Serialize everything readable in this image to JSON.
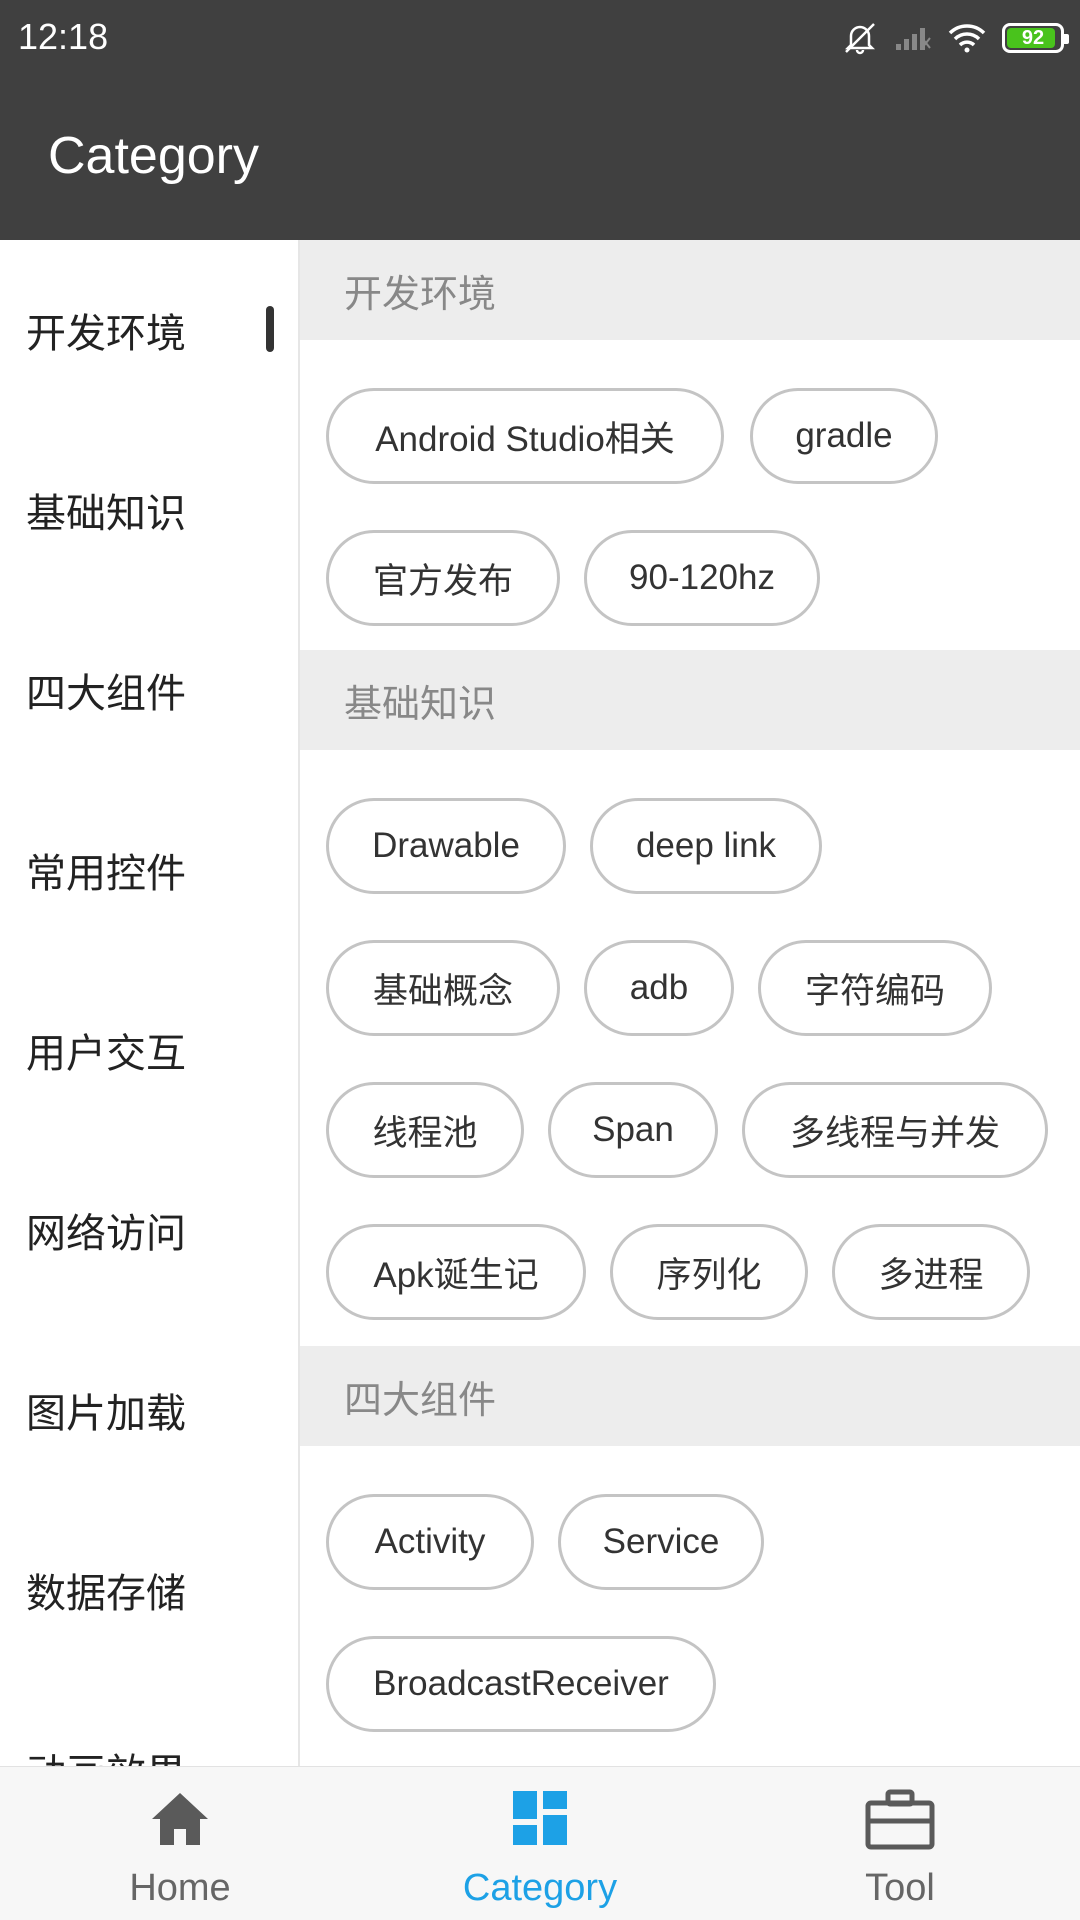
{
  "status_bar": {
    "time": "12:18",
    "battery_level": "92",
    "icons": [
      "mute-icon",
      "signal-icon",
      "wifi-icon",
      "battery-icon"
    ]
  },
  "app_bar": {
    "title": "Category"
  },
  "sidebar": {
    "items": [
      {
        "label": "开发环境",
        "selected": true
      },
      {
        "label": "基础知识"
      },
      {
        "label": "四大组件"
      },
      {
        "label": "常用控件"
      },
      {
        "label": "用户交互"
      },
      {
        "label": "网络访问"
      },
      {
        "label": "图片加载"
      },
      {
        "label": "数据存储"
      },
      {
        "label": "动画效果"
      }
    ]
  },
  "sections": [
    {
      "title": "开发环境",
      "tags": [
        "Android Studio相关",
        "gradle",
        "官方发布",
        "90-120hz"
      ]
    },
    {
      "title": "基础知识",
      "tags": [
        "Drawable",
        "deep link",
        "基础概念",
        "adb",
        "字符编码",
        "线程池",
        "Span",
        "多线程与并发",
        "Apk诞生记",
        "序列化",
        "多进程"
      ]
    },
    {
      "title": "四大组件",
      "tags": [
        "Activity",
        "Service",
        "BroadcastReceiver"
      ]
    }
  ],
  "bottom_nav": {
    "items": [
      {
        "label": "Home",
        "icon": "home-icon"
      },
      {
        "label": "Category",
        "icon": "category-icon",
        "active": true
      },
      {
        "label": "Tool",
        "icon": "toolbox-icon"
      }
    ]
  },
  "colors": {
    "app_bar": "#404040",
    "accent": "#1da1e6",
    "section_header_bg": "#ededed",
    "battery_green": "#49c31c"
  }
}
